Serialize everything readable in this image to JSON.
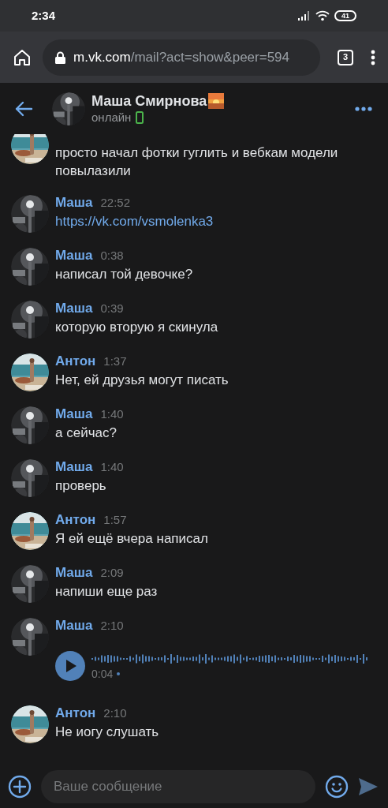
{
  "status_bar": {
    "time": "2:34",
    "battery": "41"
  },
  "browser": {
    "url_host": "m.vk.com",
    "url_path": "/mail?act=show&peer=594",
    "tab_count": "3"
  },
  "chat_header": {
    "name": "Маша Смирнова",
    "status": "онлайн"
  },
  "messages": [
    {
      "kind": "text",
      "from_me": true,
      "text": "просто начал фотки гуглить и вебкам модели повылазили"
    },
    {
      "kind": "text",
      "from_me": false,
      "sender": "Маша",
      "time": "22:52",
      "text": "https://vk.com/vsmolenka3",
      "link": true
    },
    {
      "kind": "text",
      "from_me": false,
      "sender": "Маша",
      "time": "0:38",
      "text": "написал той девочке?"
    },
    {
      "kind": "text",
      "from_me": false,
      "sender": "Маша",
      "time": "0:39",
      "text": "которую вторую я скинула"
    },
    {
      "kind": "text",
      "from_me": true,
      "sender": "Антон",
      "time": "1:37",
      "text": "Нет, ей друзья могут писать"
    },
    {
      "kind": "text",
      "from_me": false,
      "sender": "Маша",
      "time": "1:40",
      "text": "а сейчас?"
    },
    {
      "kind": "text",
      "from_me": false,
      "sender": "Маша",
      "time": "1:40",
      "text": "проверь"
    },
    {
      "kind": "text",
      "from_me": true,
      "sender": "Антон",
      "time": "1:57",
      "text": "Я ей ещё вчера написал"
    },
    {
      "kind": "text",
      "from_me": false,
      "sender": "Маша",
      "time": "2:09",
      "text": "напиши еще раз"
    },
    {
      "kind": "voice",
      "from_me": false,
      "sender": "Маша",
      "time": "2:10",
      "duration": "0:04",
      "unread": true
    },
    {
      "kind": "text",
      "from_me": true,
      "sender": "Антон",
      "time": "2:10",
      "text": "Не иогу слушать"
    }
  ],
  "composer": {
    "placeholder": "Ваше сообщение"
  }
}
